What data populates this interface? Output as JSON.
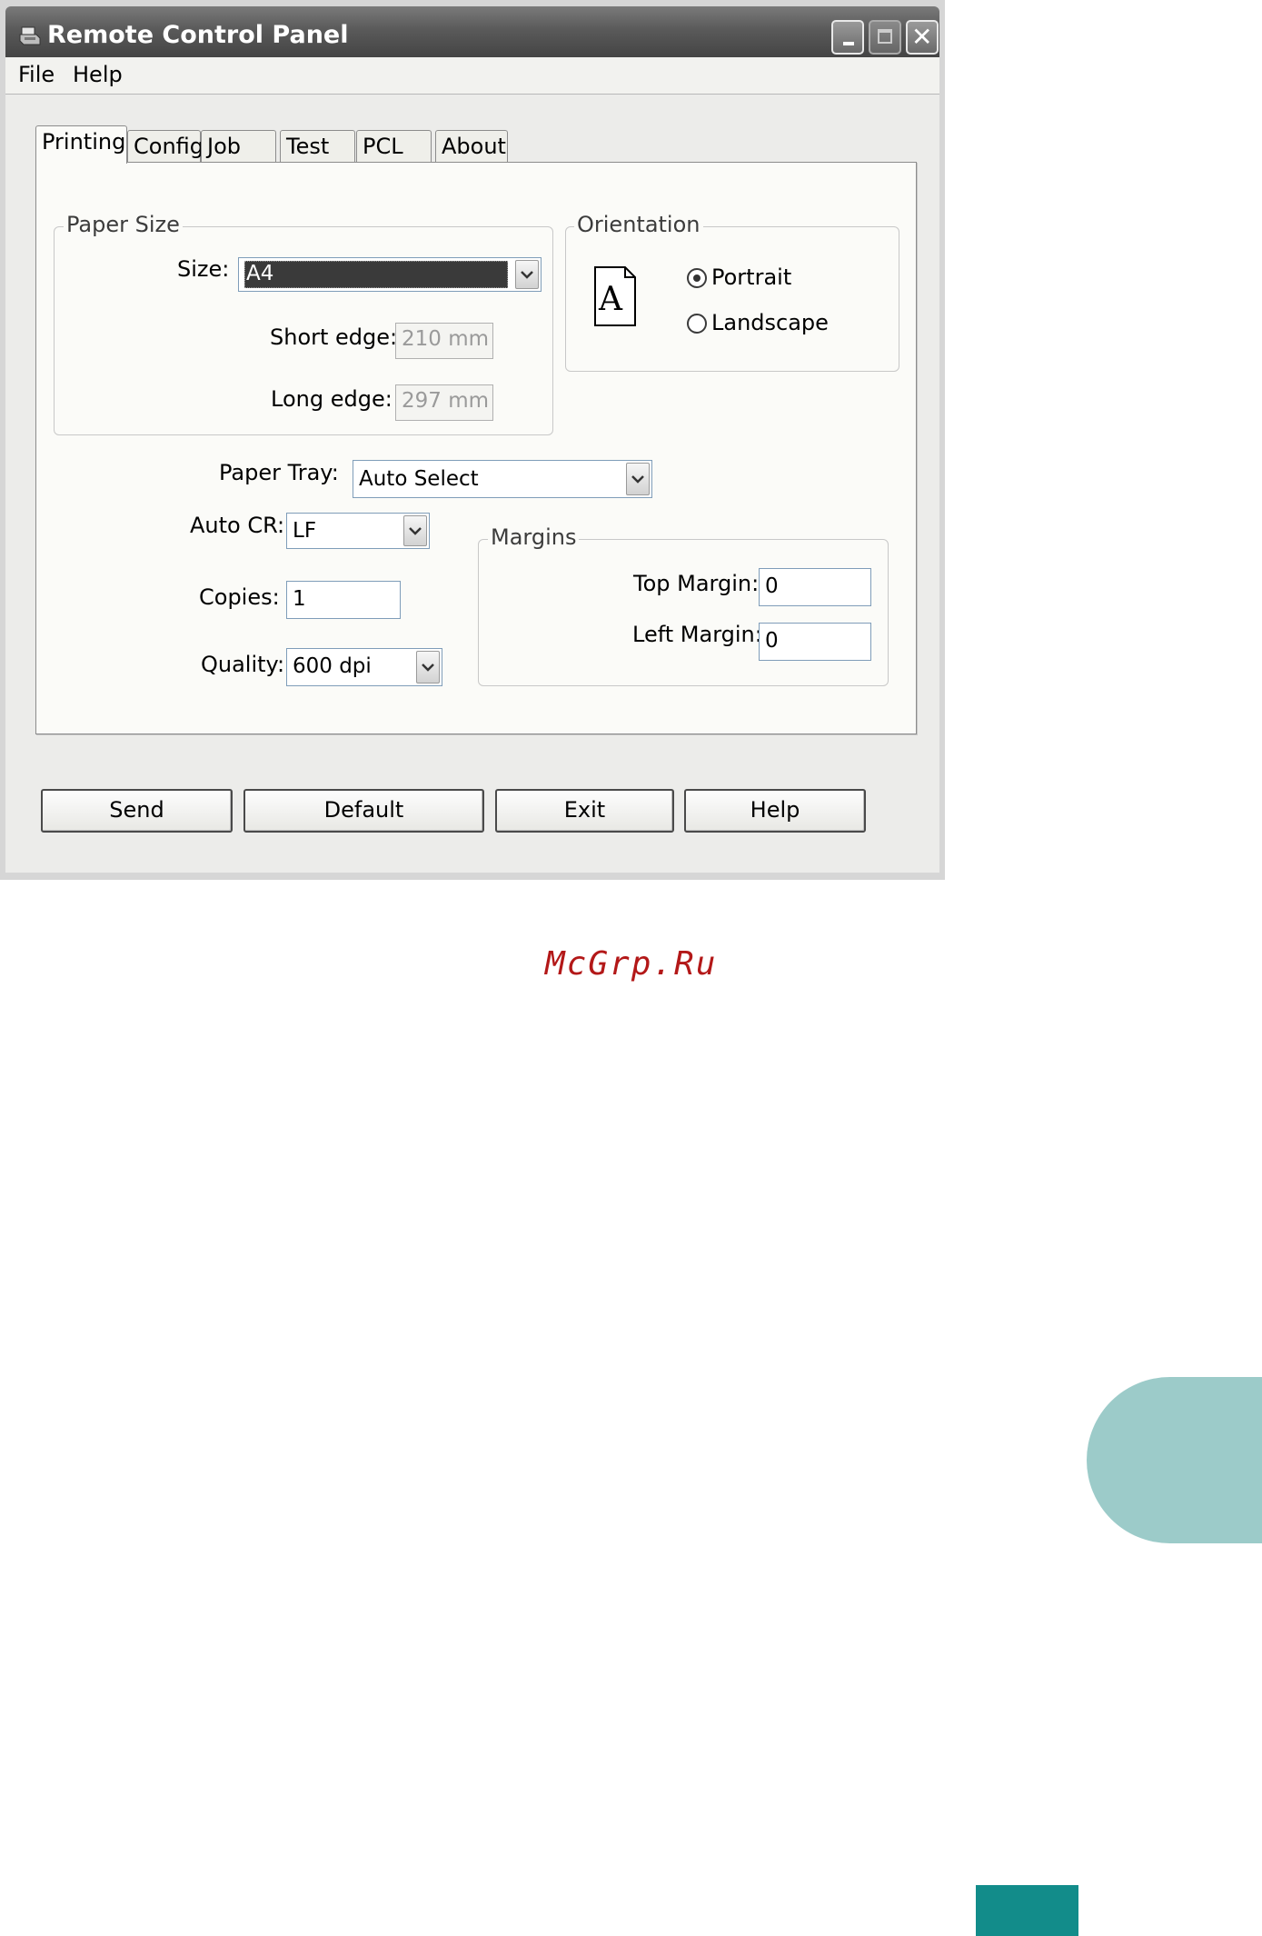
{
  "window": {
    "title": "Remote Control Panel",
    "menu": [
      "File",
      "Help"
    ]
  },
  "tabs": [
    {
      "label": "Printing",
      "active": true
    },
    {
      "label": "Config",
      "active": false
    },
    {
      "label": "Job",
      "active": false
    },
    {
      "label": "Test",
      "active": false
    },
    {
      "label": "PCL",
      "active": false
    },
    {
      "label": "About",
      "active": false
    }
  ],
  "paper_size": {
    "group_label": "Paper Size",
    "size_label": "Size:",
    "size_value": "A4",
    "short_edge_label": "Short edge:",
    "short_edge_value": "210 mm",
    "long_edge_label": "Long edge:",
    "long_edge_value": "297 mm"
  },
  "orientation": {
    "group_label": "Orientation",
    "portrait_label": "Portrait",
    "landscape_label": "Landscape",
    "selected": "Portrait",
    "icon_letter": "A"
  },
  "paper_tray": {
    "label": "Paper Tray:",
    "value": "Auto Select"
  },
  "auto_cr": {
    "label": "Auto CR:",
    "value": "LF"
  },
  "copies": {
    "label": "Copies:",
    "value": "1"
  },
  "quality": {
    "label": "Quality:",
    "value": "600 dpi"
  },
  "margins": {
    "group_label": "Margins",
    "top_label": "Top Margin:",
    "top_value": "0",
    "left_label": "Left Margin:",
    "left_value": "0"
  },
  "buttons": {
    "send": "Send",
    "default": "Default",
    "exit": "Exit",
    "help": "Help"
  },
  "page": {
    "watermark": "McGrp.Ru",
    "accent_colors": {
      "side_tab": "#9ccbc9",
      "page_block": "#128c8a",
      "watermark": "#b31818"
    }
  }
}
